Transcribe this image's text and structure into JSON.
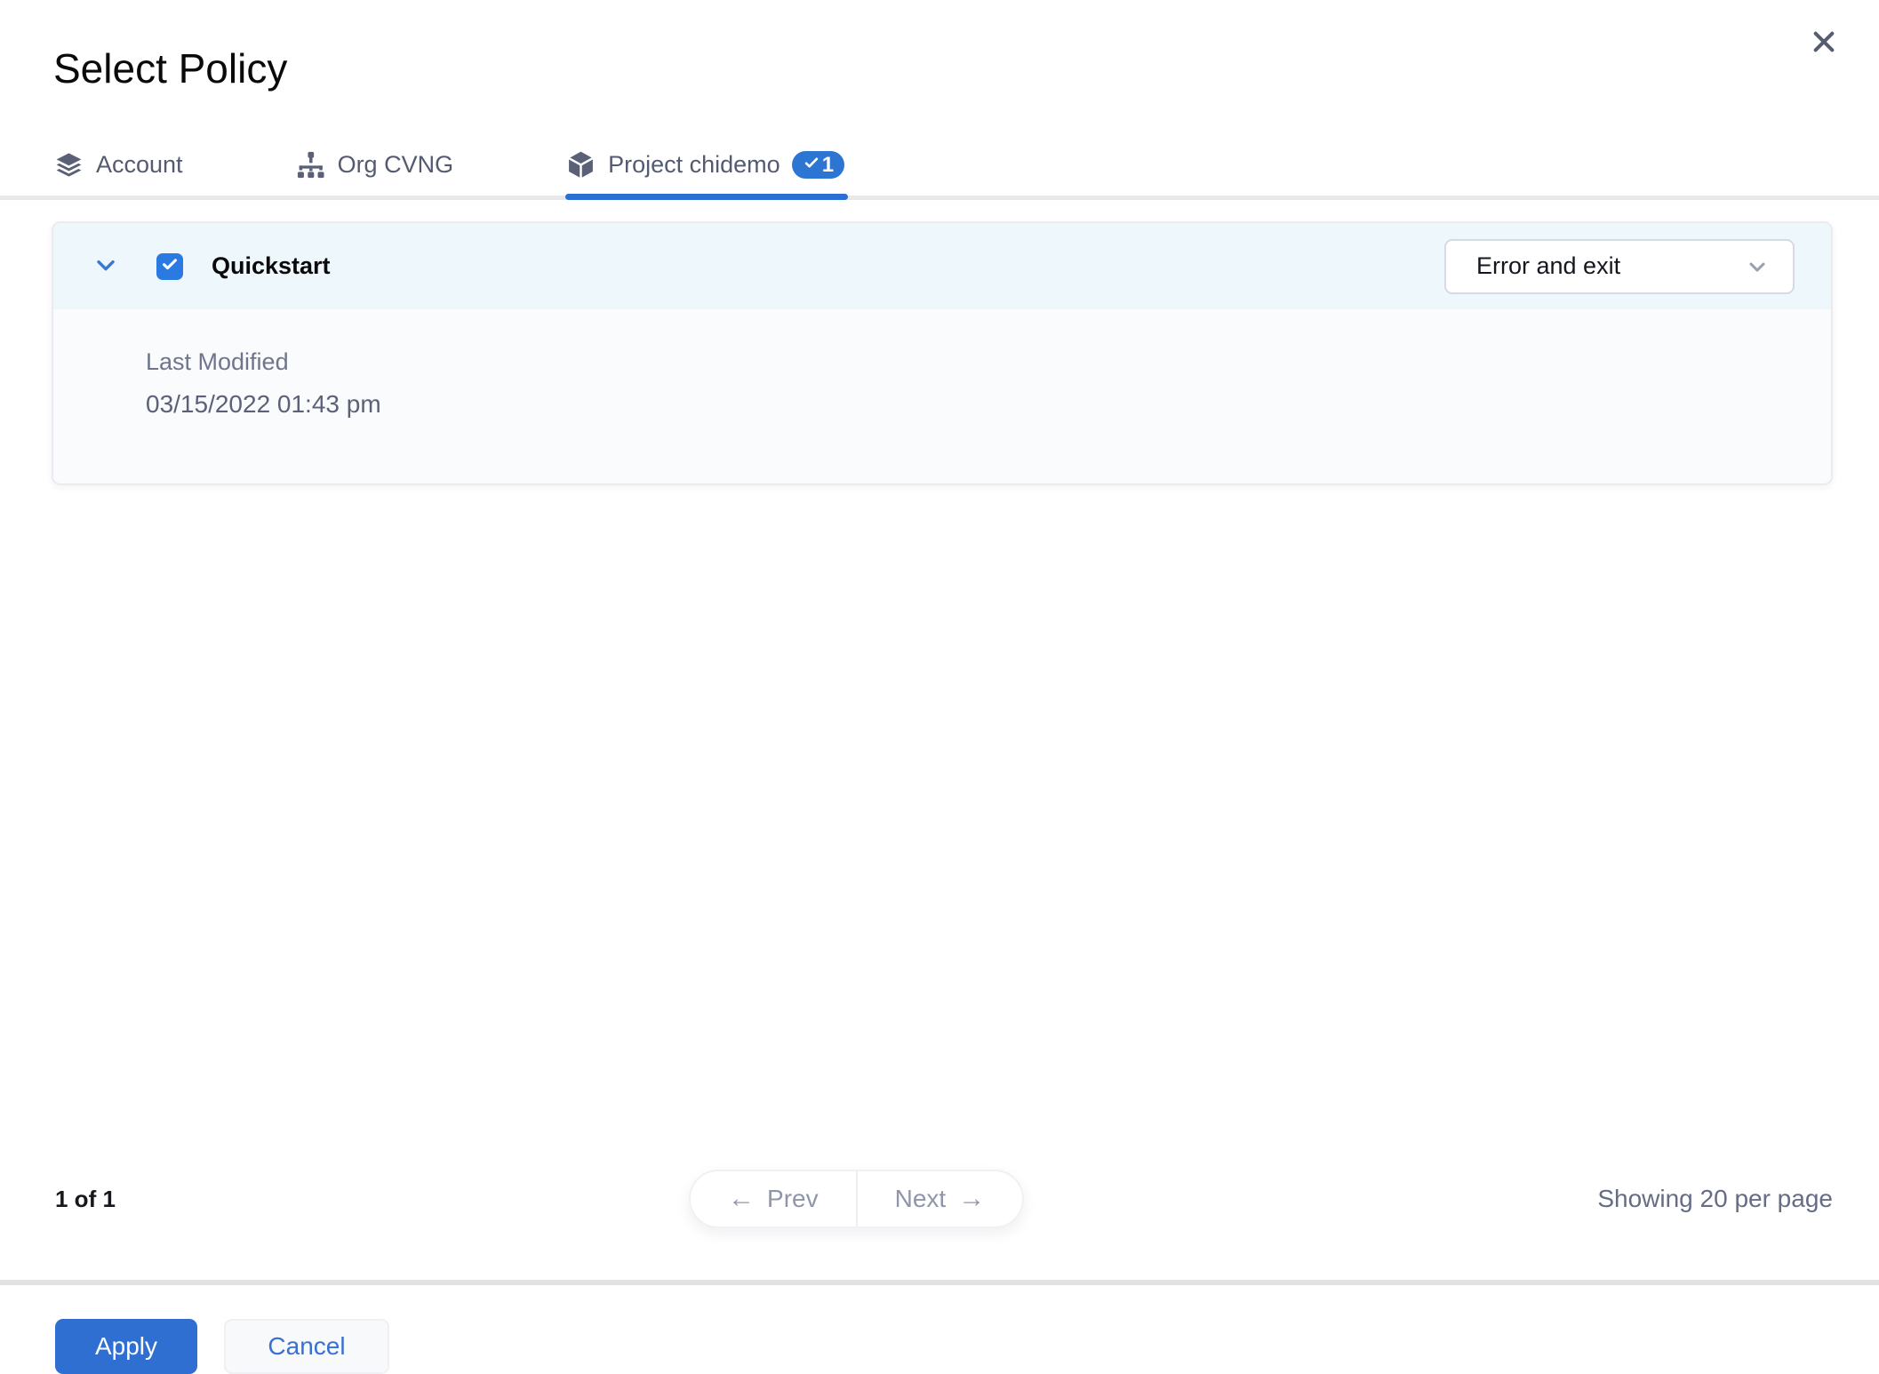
{
  "modal": {
    "title": "Select Policy"
  },
  "tabs": [
    {
      "label": "Account",
      "icon": "layers-icon",
      "active": false
    },
    {
      "label": "Org CVNG",
      "icon": "org-hierarchy-icon",
      "active": false
    },
    {
      "label": "Project chidemo",
      "icon": "cube-icon",
      "active": true,
      "badge_count": "1"
    }
  ],
  "policy": {
    "name": "Quickstart",
    "checked": true,
    "action_select_value": "Error and exit",
    "details": {
      "label": "Last Modified",
      "value": "03/15/2022 01:43 pm"
    }
  },
  "pagination": {
    "page_indicator": "1 of 1",
    "prev_label": "Prev",
    "next_label": "Next",
    "per_page": "Showing 20 per page"
  },
  "footer": {
    "apply_label": "Apply",
    "cancel_label": "Cancel"
  },
  "icons": {
    "arrow_left": "←",
    "arrow_right": "→"
  },
  "colors": {
    "primary_blue": "#2f6fd2",
    "checkbox_blue": "#2b7ae2",
    "badge_blue": "#2d75d2",
    "tab_text_slate": "#545b71",
    "row_header_bg": "#eef7fb",
    "row_body_bg": "#fafbfc",
    "muted_text": "#666c84",
    "divider_gray": "#e2e2e4"
  }
}
